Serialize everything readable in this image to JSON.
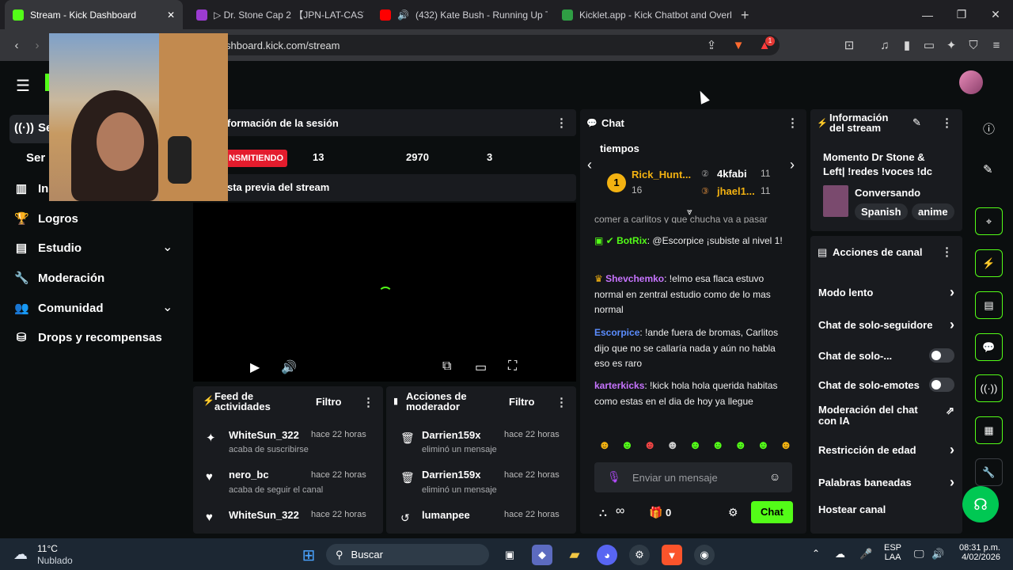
{
  "browser": {
    "tabs": [
      {
        "title": "Stream - Kick Dashboard",
        "active": true,
        "fav_color": "#53fc18"
      },
      {
        "title": "▷ Dr. Stone Cap 2 【JPN-LAT-CAST】[",
        "active": false,
        "fav_color": "#9b3bd1"
      },
      {
        "title": "(432) Kate Bush - Running Up Tha",
        "active": false,
        "fav_color": "#ff0000"
      },
      {
        "title": "Kicklet.app - Kick Chatbot and Overl",
        "active": false,
        "fav_color": "#2f9e44"
      }
    ],
    "new_tab": "+",
    "url": "shboard.kick.com/stream",
    "shield_badge": "1"
  },
  "sidebar": {
    "items": [
      {
        "label": "Se",
        "icon": "broadcast-icon"
      },
      {
        "label": "Ser",
        "icon": ""
      },
      {
        "label": "In",
        "icon": "chart-icon"
      },
      {
        "label": "Logros",
        "icon": "trophy-icon"
      },
      {
        "label": "Estudio",
        "icon": "studio-icon",
        "expand": "⌄"
      },
      {
        "label": "Moderación",
        "icon": "wrench-icon"
      },
      {
        "label": "Comunidad",
        "icon": "people-icon",
        "expand": "⌄"
      },
      {
        "label": "Drops y recompensas",
        "icon": "drops-icon"
      }
    ]
  },
  "session": {
    "title": "formación de la sesión",
    "status": "NSMITIENDO",
    "stats": [
      "13",
      "2970",
      "3"
    ],
    "preview_title": "sta previa del stream"
  },
  "feed": {
    "title_line1": "Feed de",
    "title_line2": "actividades",
    "filter": "Filtro",
    "items": [
      {
        "name": "WhiteSun_322",
        "time": "hace 22 horas",
        "sub": "acaba de suscribirse"
      },
      {
        "name": "nero_bc",
        "time": "hace 22 horas",
        "sub": "acaba de seguir el canal"
      },
      {
        "name": "WhiteSun_322",
        "time": "hace 22 horas",
        "sub": ""
      }
    ]
  },
  "mod": {
    "title_line1": "Acciones de",
    "title_line2": "moderador",
    "filter": "Filtro",
    "items": [
      {
        "name": "Darrien159x",
        "time": "hace 22 horas",
        "sub": "eliminó un mensaje"
      },
      {
        "name": "Darrien159x",
        "time": "hace 22 horas",
        "sub": "eliminó un mensaje"
      },
      {
        "name": "lumanpee",
        "time": "hace 22 horas",
        "sub": ""
      }
    ]
  },
  "chat": {
    "title": "Chat",
    "leaderboard_title": "tiempos",
    "leader1": {
      "name": "Rick_Hunt...",
      "count": "16"
    },
    "leader2": {
      "name": "4kfabi",
      "count": "11"
    },
    "leader3": {
      "name": "jhael1...",
      "count": "11"
    },
    "partial_line": "comer a carlitos y que chucha va a pasar",
    "messages": [
      {
        "user": "BotRix",
        "color": "#53fc18",
        "text": ": @Escorpice ¡subiste al nivel 1!"
      },
      {
        "user": "Shevchemko",
        "color": "#c774ff",
        "text": ": !elmo esa flaca estuvo normal en zentral estudio como de lo mas normal"
      },
      {
        "user": "Escorpice",
        "color": "#5b8dff",
        "text": ": !ande fuera de bromas, Carlitos dijo que no se callaría nada y aún no habla eso es raro"
      },
      {
        "user": "karterkicks",
        "color": "#c774ff",
        "text": ": !kick hola hola querida habitas como estas en el dia de hoy ya llegue"
      }
    ],
    "input_placeholder": "Enviar un mensaje",
    "infinity": "∞",
    "count": "0",
    "send": "Chat"
  },
  "info": {
    "title_line1": "Información",
    "title_line2": "del stream",
    "stream_title": "Momento Dr Stone & Left| !redes !voces !dc",
    "category": "Conversando",
    "tags": [
      "Spanish",
      "anime"
    ]
  },
  "actions": {
    "title": "Acciones de canal",
    "rows": [
      {
        "label": "Modo lento",
        "kind": "arrow"
      },
      {
        "label": "Chat de solo-seguidore",
        "kind": "arrow"
      },
      {
        "label": "Chat de solo-...",
        "kind": "toggle"
      },
      {
        "label": "Chat de solo-emotes",
        "kind": "toggle"
      },
      {
        "label": "Moderación del chat con IA",
        "kind": "link"
      },
      {
        "label": "Restricción de edad",
        "kind": "arrow"
      },
      {
        "label": "Palabras baneadas",
        "kind": "arrow"
      },
      {
        "label": "Hostear canal",
        "kind": "none"
      }
    ]
  },
  "taskbar": {
    "weather_temp": "11°C",
    "weather_desc": "Nublado",
    "search": "Buscar",
    "lang1": "ESP",
    "lang2": "LAA",
    "time": "08:31 p.m.",
    "date": "4/02/2026"
  }
}
